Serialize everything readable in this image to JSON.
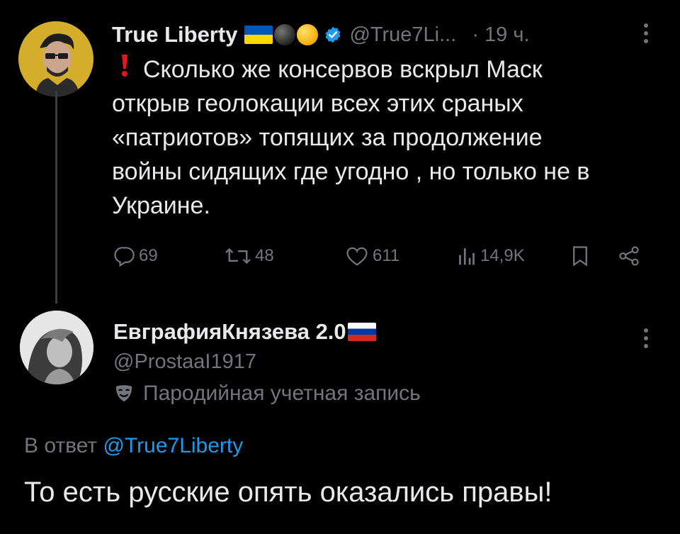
{
  "tweet": {
    "author_name": "True Liberty",
    "author_handle": "@True7Li...",
    "time": "· 19 ч.",
    "alert_icon": "red-exclamation",
    "text_lines": [
      "Сколько же консервов вскрыл Маск",
      "открыв геолокации всех этих сраных",
      "«патриотов» топящих за продолжение",
      "войны сидящих где угодно , но только не в",
      "Украине."
    ],
    "replies": "69",
    "reposts": "48",
    "likes": "611",
    "views": "14,9K",
    "verified_color": "#1d9bf0"
  },
  "reply": {
    "author_name": "ЕвграфияКнязева 2.0",
    "author_handle": "@ProstaaI1917",
    "parody_label": "Пародийная учетная запись",
    "in_reply_prefix": "В ответ",
    "in_reply_mention": "@True7Liberty",
    "text": "То есть русские опять оказались правы!",
    "mention_color": "#1d9bf0"
  }
}
